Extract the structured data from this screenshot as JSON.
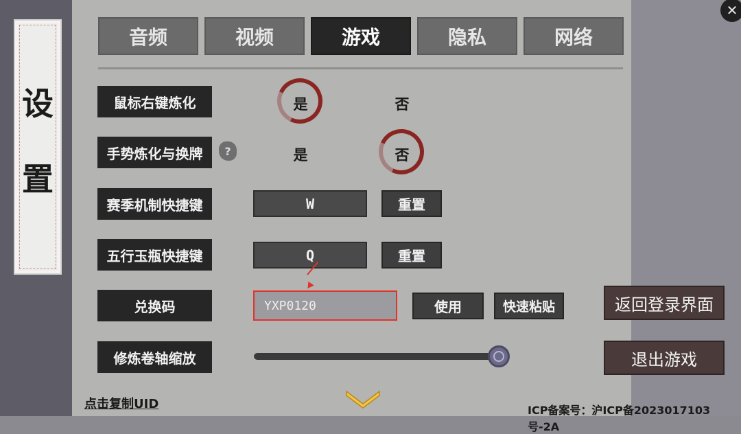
{
  "sidebar": {
    "title_char_1": "设",
    "title_char_2": "置"
  },
  "tabs": [
    {
      "label": "音频"
    },
    {
      "label": "视频"
    },
    {
      "label": "游戏",
      "active": true
    },
    {
      "label": "隐私"
    },
    {
      "label": "网络"
    }
  ],
  "settings": {
    "right_click_refine": {
      "label": "鼠标右键炼化",
      "yes": "是",
      "no": "否",
      "selected": "是"
    },
    "gesture_refine": {
      "label": "手势炼化与换牌",
      "help_icon": "question-icon",
      "yes": "是",
      "no": "否",
      "selected": "否"
    },
    "season_hotkey": {
      "label": "赛季机制快捷键",
      "key": "W",
      "reset": "重置"
    },
    "wuxing_hotkey": {
      "label": "五行玉瓶快捷键",
      "key": "Q",
      "reset": "重置"
    },
    "redeem_code": {
      "label": "兑换码",
      "value": "YXP0120",
      "use": "使用",
      "paste": "快速粘贴"
    },
    "scroll_zoom": {
      "label": "修炼卷轴缩放",
      "value_fraction": 1.0
    }
  },
  "side_buttons": {
    "return_login": "返回登录界面",
    "exit_game": "退出游戏"
  },
  "footer": {
    "copy_uid": "点击复制UID",
    "icp": "ICP备案号：沪ICP备2023017103号-2A"
  },
  "colors": {
    "accent_ring": "#8a2622",
    "highlight": "#e0332c"
  }
}
